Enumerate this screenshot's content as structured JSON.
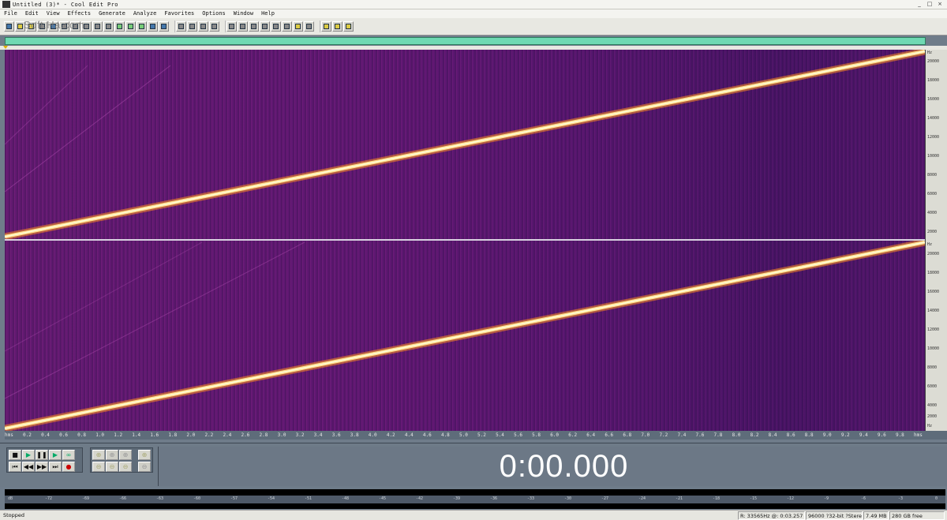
{
  "window": {
    "title": "Untitled (3)* - Cool Edit Pro",
    "controls": [
      "_",
      "□",
      "×"
    ]
  },
  "menu": [
    "File",
    "Edit",
    "View",
    "Effects",
    "Generate",
    "Analyze",
    "Favorites",
    "Options",
    "Window",
    "Help"
  ],
  "watermark": "Soft.Ha.com",
  "hz_scale_top": [
    "Hz",
    "20000",
    "18000",
    "16000",
    "14000",
    "12000",
    "10000",
    "8000",
    "6000",
    "4000",
    "2000"
  ],
  "hz_scale_bottom": [
    "Hz",
    "20000",
    "18000",
    "16000",
    "14000",
    "12000",
    "10000",
    "8000",
    "6000",
    "4000",
    "2000",
    "Hz"
  ],
  "time_ruler": [
    "hms",
    "0.2",
    "0.4",
    "0.6",
    "0.8",
    "1.0",
    "1.2",
    "1.4",
    "1.6",
    "1.8",
    "2.0",
    "2.2",
    "2.4",
    "2.6",
    "2.8",
    "3.0",
    "3.2",
    "3.4",
    "3.6",
    "3.8",
    "4.0",
    "4.2",
    "4.4",
    "4.6",
    "4.8",
    "5.0",
    "5.2",
    "5.4",
    "5.6",
    "5.8",
    "6.0",
    "6.2",
    "6.4",
    "6.6",
    "6.8",
    "7.0",
    "7.2",
    "7.4",
    "7.6",
    "7.8",
    "8.0",
    "8.2",
    "8.4",
    "8.6",
    "8.8",
    "9.0",
    "9.2",
    "9.4",
    "9.6",
    "9.8",
    "hms"
  ],
  "time_display": "0:00.000",
  "level_scale": [
    "dB",
    "-72",
    "-69",
    "-66",
    "-63",
    "-60",
    "-57",
    "-54",
    "-51",
    "-48",
    "-45",
    "-42",
    "-39",
    "-36",
    "-33",
    "-30",
    "-27",
    "-24",
    "-21",
    "-18",
    "-15",
    "-12",
    "-9",
    "-6",
    "-3",
    "0"
  ],
  "status": {
    "state": "Stopped",
    "cursor": "R: 33565Hz @: 0:03.257",
    "format": "96000 ?32-bit ?Stereo",
    "size": "7.49 MB",
    "free": "280 GB free"
  },
  "colors": {
    "spectrum_bg": "#6a1c79",
    "sweep": "#fff4b0",
    "overview": "#6fd9b3"
  }
}
